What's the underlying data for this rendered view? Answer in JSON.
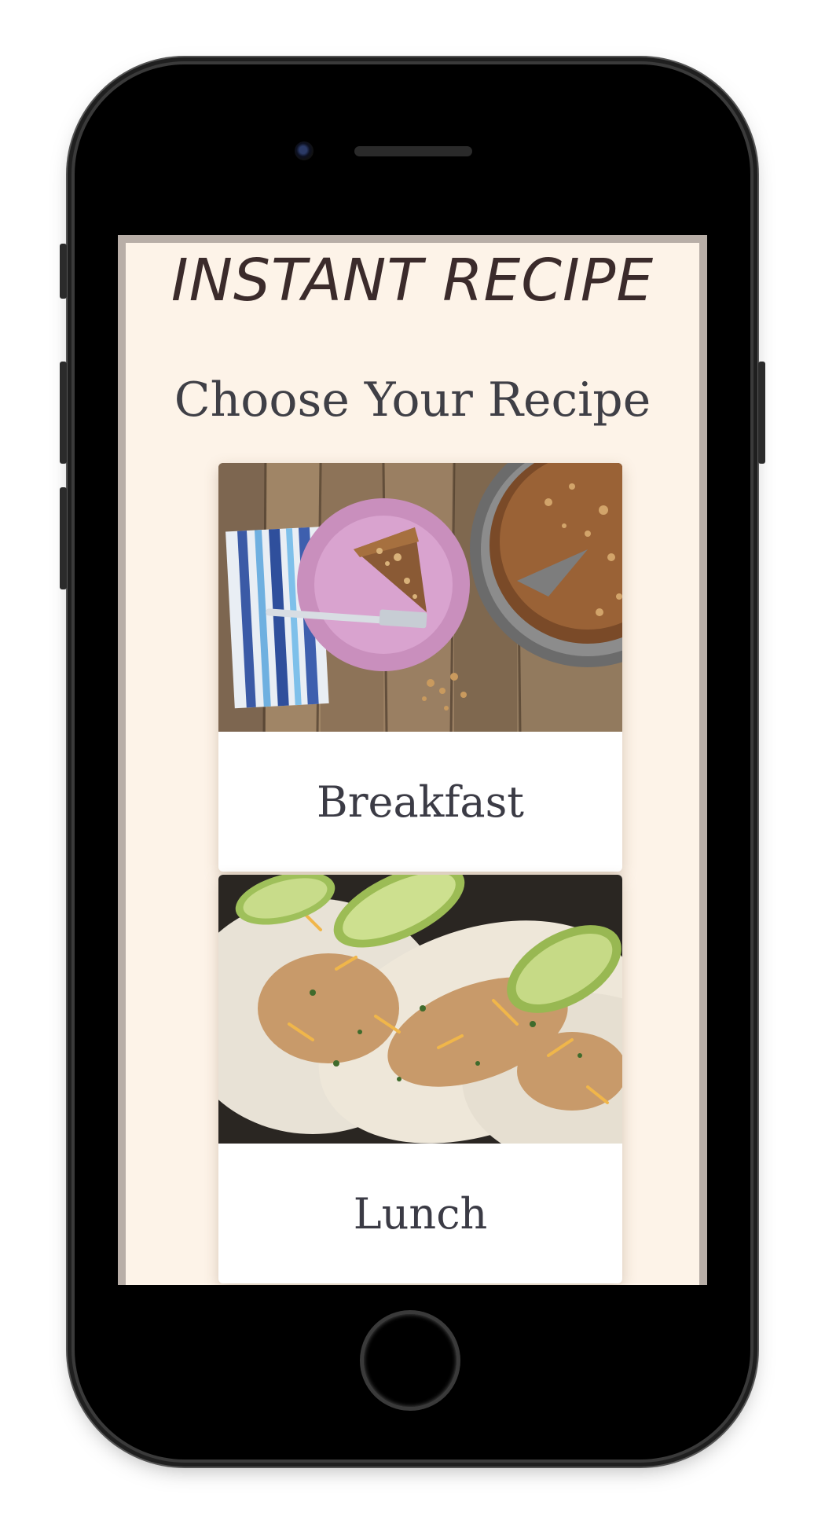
{
  "app": {
    "title": "INSTANT RECIPE",
    "subtitle": "Choose Your Recipe"
  },
  "cards": [
    {
      "label": "Breakfast",
      "image": "coffee-cake-slice-photo"
    },
    {
      "label": "Lunch",
      "image": "chicken-tacos-photo"
    }
  ],
  "colors": {
    "page_background": "#fdf3e8",
    "title_text": "#3b2b2b",
    "card_text": "#3b3b45",
    "card_background": "#ffffff"
  }
}
